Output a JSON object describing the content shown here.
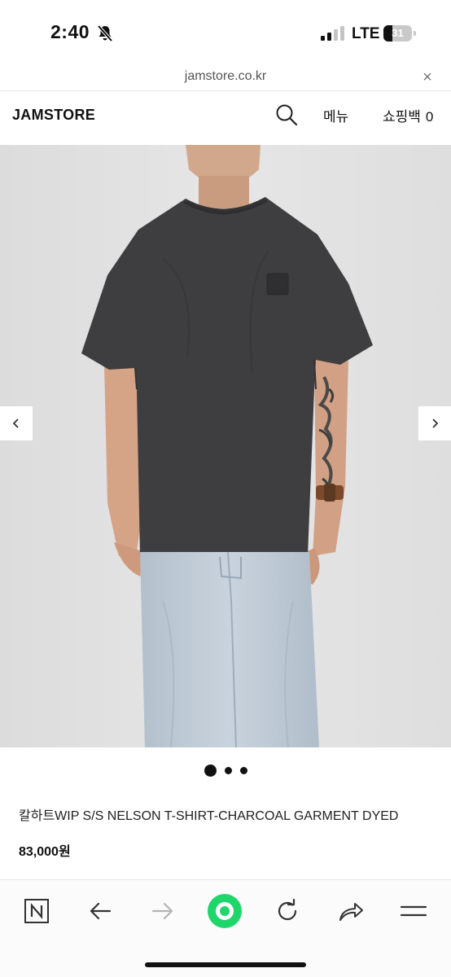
{
  "status_bar": {
    "time": "2:40",
    "network": "LTE",
    "battery": "31",
    "battery_level": 0.31,
    "icons": [
      "bell-slash-icon",
      "signal-icon",
      "battery-icon"
    ]
  },
  "browser": {
    "url": "jamstore.co.kr",
    "close_icon": "×"
  },
  "header": {
    "logo": "JAMSTORE",
    "menu_label": "메뉴",
    "cart_label": "쇼핑백",
    "cart_count": "0"
  },
  "carousel": {
    "total_slides": 3,
    "current_slide": 1
  },
  "product": {
    "name": "칼하트WIP S/S NELSON T-SHIRT-CHARCOAL GARMENT DYED",
    "price": "83,000원"
  },
  "colors": {
    "shirt": "#3d3d3f",
    "jeans": "#bfcbd6",
    "background": "#e2e2e3",
    "accent": "#1ed760"
  },
  "toolbar": {
    "icons": [
      "naver-icon",
      "back-arrow-icon",
      "forward-arrow-icon",
      "green-home-icon",
      "reload-icon",
      "share-icon",
      "menu-icon"
    ]
  }
}
